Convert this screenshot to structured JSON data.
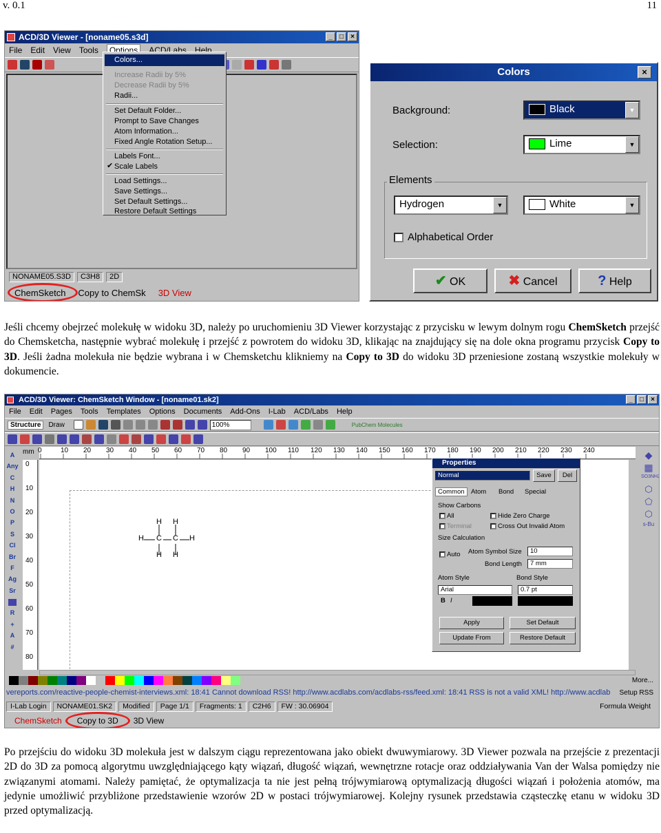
{
  "page_header": {
    "version": "v. 0.1",
    "page_number": "11"
  },
  "viewer_window": {
    "title": "ACD/3D Viewer - [noname05.s3d]",
    "title_buttons": [
      "_",
      "□",
      "×"
    ],
    "menu": [
      "File",
      "Edit",
      "View",
      "Tools",
      "Options",
      "ACD/Labs",
      "Help"
    ],
    "options_menu": {
      "selected": "Colors...",
      "items": [
        "Increase Radii by 5%",
        "Decrease Radii by 5%",
        "Radii...",
        "Set Default Folder...",
        "Prompt to Save Changes",
        "Atom Information...",
        "Fixed Angle Rotation Setup...",
        "Labels Font...",
        "Scale Labels",
        "Load Settings...",
        "Save Settings...",
        "Set Default Settings...",
        "Restore Default Settings"
      ]
    },
    "status_cells": [
      "NONAME05.S3D",
      "C3H8",
      "2D"
    ],
    "bottom_tabs": [
      "ChemSketch",
      "Copy to ChemSk",
      "3D View"
    ]
  },
  "colors_dialog": {
    "title": "Colors",
    "close": "×",
    "background_label": "Background:",
    "background_value": "Black",
    "selection_label": "Selection:",
    "selection_value": "Lime",
    "elements_group": "Elements",
    "element_value": "Hydrogen",
    "element_color": "White",
    "alphabetical_label": "Alphabetical Order",
    "ok": "OK",
    "cancel": "Cancel",
    "help": "Help"
  },
  "paragraph1": {
    "t1": "Jeśli chcemy obejrzeć molekułę w widoku 3D, należy po uruchomieniu 3D Viewer korzystając z przycisku w lewym dolnym rogu ",
    "b1": "ChemSketch",
    "t2": " przejść do Chemsketcha, następnie wybrać molekułę i przejść z powrotem do widoku 3D, klikając na znajdujący się na dole okna programu przycisk ",
    "b2": "Copy to 3D",
    "t3": ". Jeśli żadna molekuła nie będzie wybrana i w Chemsketchu klikniemy na ",
    "b3": "Copy to 3D",
    "t4": " do widoku 3D przeniesione zostaną wszystkie molekuły w dokumencie."
  },
  "chemsketch_window": {
    "title": "ACD/3D Viewer: ChemSketch Window - [noname01.sk2]",
    "title_buttons": [
      "_",
      "□",
      "×"
    ],
    "menu": [
      "File",
      "Edit",
      "Pages",
      "Tools",
      "Templates",
      "Options",
      "Documents",
      "Add-Ons",
      "I-Lab",
      "ACD/Labs",
      "Help"
    ],
    "mode_tabs": [
      "Structure",
      "Draw"
    ],
    "zoom": "100%",
    "pubchem_label": "PubChem Molecules",
    "ruler_unit": "mm",
    "ruler_h": [
      "0",
      "10",
      "20",
      "30",
      "40",
      "50",
      "60",
      "70",
      "80",
      "90",
      "100",
      "110",
      "120",
      "130",
      "140",
      "150",
      "160",
      "170",
      "180",
      "190",
      "200",
      "210",
      "220",
      "230",
      "240"
    ],
    "ruler_v": [
      "0",
      "10",
      "20",
      "30",
      "40",
      "50",
      "60",
      "70",
      "80"
    ],
    "atoms_left": [
      "A",
      "Any",
      "C",
      "H",
      "N",
      "O",
      "P",
      "S",
      "Cl",
      "Br",
      "F",
      "Ag",
      "Sr",
      "",
      "R",
      "+",
      "A",
      "#"
    ],
    "right_labels": [
      "SO3NH2",
      "s-Bu"
    ],
    "molecule_atoms": {
      "h": "H",
      "c": "C"
    },
    "properties": {
      "title": "Properties",
      "style": "Normal",
      "save": "Save",
      "del": "Del",
      "tabs": [
        "Common",
        "Atom",
        "Bond",
        "Special"
      ],
      "show_carbons": "Show Carbons",
      "all": "All",
      "terminal": "Terminal",
      "hide_zero_charge": "Hide Zero Charge",
      "cross_out_invalid": "Cross Out Invalid Atom",
      "size_calculation": "Size Calculation",
      "auto": "Auto",
      "atom_symbol_size_label": "Atom Symbol Size",
      "atom_symbol_size": "10",
      "bond_length_label": "Bond Length",
      "bond_length": "7 mm",
      "atom_style": "Atom Style",
      "bond_style": "Bond Style",
      "font": "Arial",
      "bond_width": "0.7 pt",
      "bold": "B",
      "italic": "I",
      "apply": "Apply",
      "set_default": "Set Default",
      "update_from": "Update From",
      "restore_default": "Restore Default"
    },
    "more": "More...",
    "rss_text": "vereports.com/reactive-people-chemist-interviews.xml: 18:41 Cannot download RSS! http://www.acdlabs.com/acdlabs-rss/feed.xml: 18:41 RSS is not a valid XML! http://www.acdlab",
    "setup_rss": "Setup RSS",
    "status": [
      "I-Lab Login",
      "NONAME01.SK2",
      "Modified",
      "Page 1/1",
      "Fragments: 1",
      "C2H6",
      "FW : 30.06904"
    ],
    "formula_weight": "Formula Weight",
    "bottom_tabs": [
      "ChemSketch",
      "Copy to 3D",
      "3D View"
    ],
    "palette": [
      "#000000",
      "#7f7f7f",
      "#800000",
      "#808000",
      "#008000",
      "#008080",
      "#000080",
      "#800080",
      "#ffffff",
      "#c0c0c0",
      "#ff0000",
      "#ffff00",
      "#00ff00",
      "#00ffff",
      "#0000ff",
      "#ff00ff",
      "#ff8040",
      "#804000",
      "#004040",
      "#0080ff",
      "#8000ff",
      "#ff0080",
      "#ffff80",
      "#80ff80"
    ]
  },
  "paragraph2": "Po przejściu do widoku 3D molekuła jest w dalszym ciągu reprezentowana jako obiekt dwuwymiarowy. 3D Viewer pozwala na przejście z prezentacji 2D do 3D za pomocą algorytmu uwzględniającego kąty wiązań, długość wiązań, wewnętrzne rotacje oraz oddziaływania Van der Walsa pomiędzy nie związanymi atomami. Należy pamiętać, że optymalizacja ta nie jest pełną trójwymiarową optymalizacją długości wiązań i położenia atomów, ma jedynie umożliwić przybliżone przedstawienie wzorów 2D w postaci trójwymiarowej. Kolejny rysunek przedstawia cząsteczkę etanu w widoku 3D przed optymalizacją.",
  "colors": {
    "titlebar": "#0a246a",
    "highlight": "#e32020",
    "lime": "#00ff00",
    "window_bg": "#c0c0c0"
  }
}
